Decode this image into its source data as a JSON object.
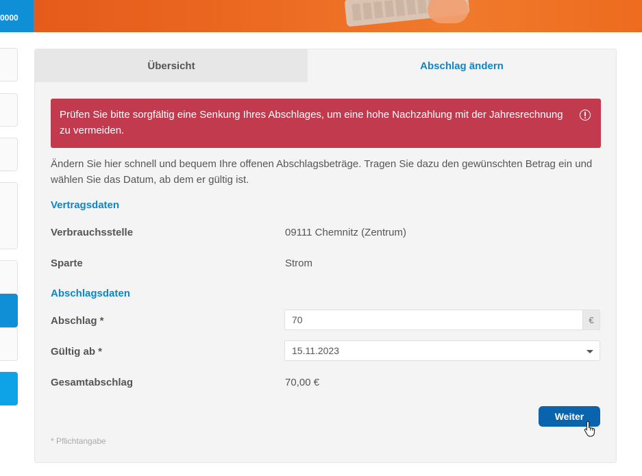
{
  "header": {
    "left_badge": "0000"
  },
  "tabs": [
    {
      "label": "Übersicht",
      "active": false
    },
    {
      "label": "Abschlag ändern",
      "active": true
    }
  ],
  "alert": {
    "text": "Prüfen Sie bitte sorgfältig eine Senkung Ihres Abschlages, um eine hohe Nachzahlung mit der Jahresrechnung zu vermeiden.",
    "icon": "alert-circle-icon"
  },
  "intro": "Ändern Sie hier schnell und bequem Ihre offenen Abschlagsbeträge. Tragen Sie dazu den gewünschten Betrag ein und wählen Sie das Datum, ab dem er gültig ist.",
  "contract": {
    "heading": "Vertragsdaten",
    "rows": [
      {
        "label": "Verbrauchsstelle",
        "value": "09111 Chemnitz (Zentrum)"
      },
      {
        "label": "Sparte",
        "value": "Strom"
      }
    ]
  },
  "installment": {
    "heading": "Abschlagsdaten",
    "amount_label": "Abschlag *",
    "amount_value": "70",
    "currency": "€",
    "valid_label": "Gültig ab *",
    "valid_value": "15.11.2023",
    "total_label": "Gesamtabschlag",
    "total_value": "70,00 €"
  },
  "actions": {
    "next_label": "Weiter"
  },
  "footnote": "* Pflichtangabe",
  "colors": {
    "primary": "#0e86c6",
    "button": "#0a64ad",
    "alert": "#c23a4e",
    "banner": "#ec6b22"
  }
}
